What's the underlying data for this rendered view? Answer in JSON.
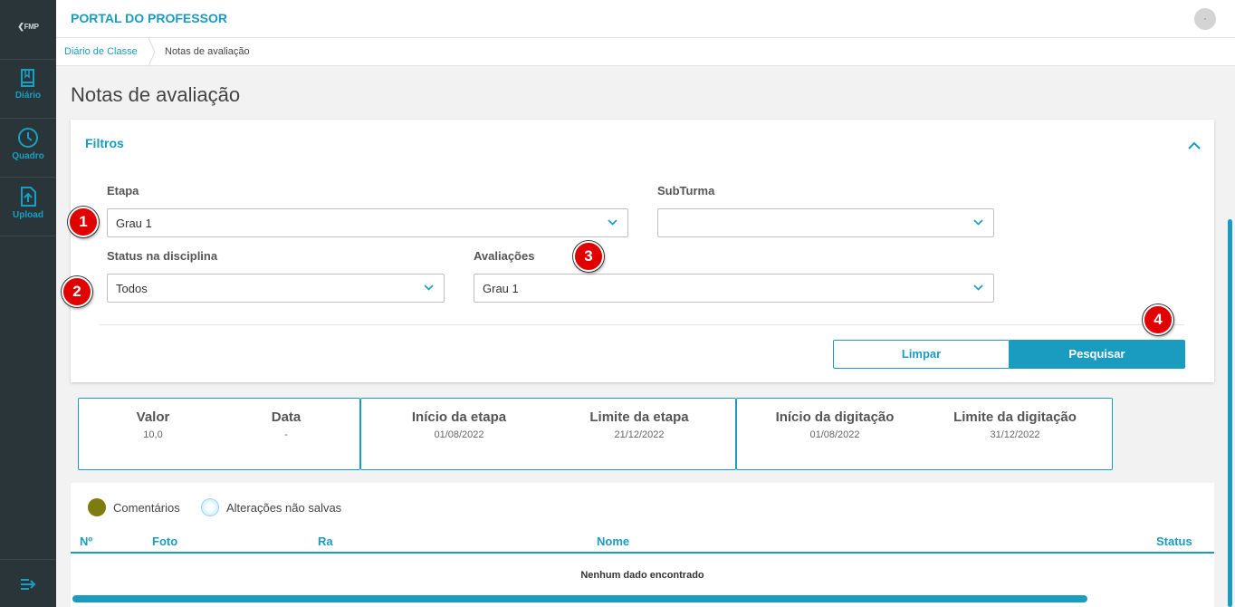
{
  "sidebar": {
    "logo": "FMP",
    "items": [
      {
        "label": "Diário",
        "icon": "book-icon"
      },
      {
        "label": "Quadro",
        "icon": "clock-icon"
      },
      {
        "label": "Upload",
        "icon": "upload-icon"
      }
    ],
    "collapse_icon": "collapse-menu-icon"
  },
  "header": {
    "title": "PORTAL DO PROFESSOR",
    "avatar_icon": "user-avatar"
  },
  "breadcrumb": [
    "Diário de Classe",
    "Notas de avaliação"
  ],
  "page": {
    "title": "Notas de avaliação"
  },
  "filters": {
    "title": "Filtros",
    "etapa": {
      "label": "Etapa",
      "value": "Grau 1"
    },
    "subturma": {
      "label": "SubTurma",
      "value": ""
    },
    "status": {
      "label": "Status na disciplina",
      "value": "Todos"
    },
    "avaliacoes": {
      "label": "Avaliações",
      "value": "Grau 1"
    },
    "clear_label": "Limpar",
    "search_label": "Pesquisar"
  },
  "markers": [
    "1",
    "2",
    "3",
    "4"
  ],
  "info": {
    "valor": {
      "label": "Valor",
      "value": "10,0"
    },
    "data": {
      "label": "Data",
      "value": "-"
    },
    "inicio_etapa": {
      "label": "Início da etapa",
      "value": "01/08/2022"
    },
    "limite_etapa": {
      "label": "Limite da etapa",
      "value": "21/12/2022"
    },
    "inicio_digitacao": {
      "label": "Início da digitação",
      "value": "01/08/2022"
    },
    "limite_digitacao": {
      "label": "Limite da digitação",
      "value": "31/12/2022"
    }
  },
  "legend": {
    "comments": {
      "label": "Comentários",
      "color": "#7d7d0f"
    },
    "unsaved": {
      "label": "Alterações não salvas",
      "color": "#bfe6f5"
    }
  },
  "table": {
    "columns": [
      "Nº",
      "Foto",
      "Ra",
      "Nome",
      "Status"
    ],
    "empty_message": "Nenhum dado encontrado"
  },
  "colors": {
    "accent": "#1a9cc0",
    "sidebar": "#293538",
    "marker": "#e00000"
  }
}
